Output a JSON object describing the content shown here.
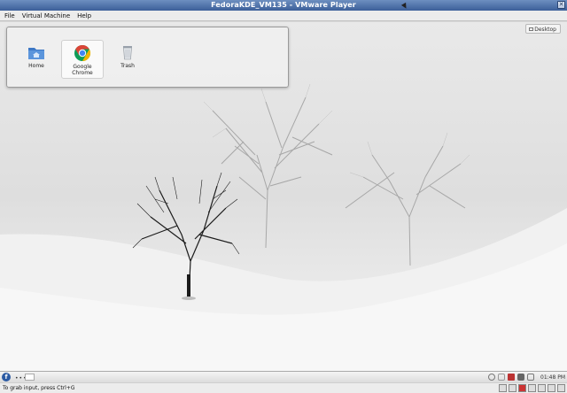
{
  "window": {
    "title": "FedoraKDE_VM135 - VMware Player"
  },
  "menubar": {
    "file": "File",
    "virtual_machine": "Virtual Machine",
    "help": "Help"
  },
  "desktop_button": {
    "label": "Desktop"
  },
  "folder_view": {
    "items": [
      {
        "label": "Home",
        "icon": "home-folder-icon"
      },
      {
        "label": "Google\nChrome",
        "icon": "chrome-icon"
      },
      {
        "label": "Trash",
        "icon": "trash-icon"
      }
    ]
  },
  "panel": {
    "clock": "01:48 PM"
  },
  "statusbar": {
    "message": "To grab input, press Ctrl+G"
  },
  "colors": {
    "titlebar": "#4a6ea9",
    "chrome_red": "#db4437",
    "chrome_yellow": "#f4b400",
    "chrome_green": "#0f9d58",
    "chrome_blue": "#4285f4",
    "folder_blue": "#3d78c5"
  }
}
